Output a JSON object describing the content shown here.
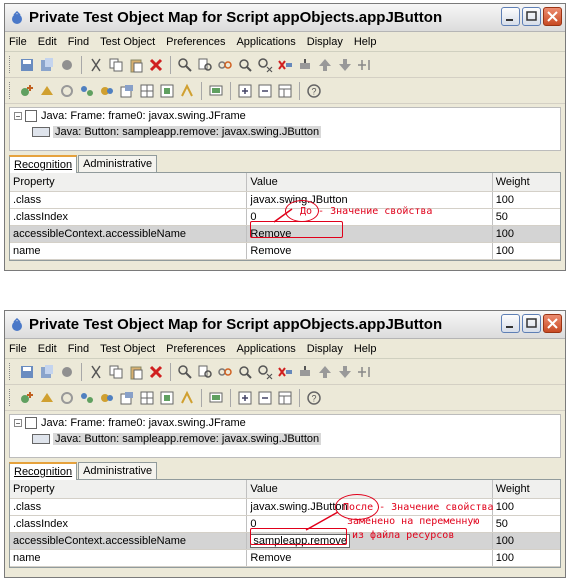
{
  "window": {
    "title": "Private Test Object Map for Script appObjects.appJButton"
  },
  "menu": [
    "File",
    "Edit",
    "Find",
    "Test Object",
    "Preferences",
    "Applications",
    "Display",
    "Help"
  ],
  "tree": {
    "frame": "Java: Frame: frame0: javax.swing.JFrame",
    "button": "Java: Button: sampleapp.remove: javax.swing.JButton"
  },
  "tabs": [
    "Recognition",
    "Administrative"
  ],
  "columns": [
    "Property",
    "Value",
    "Weight"
  ],
  "panel1": {
    "rows": [
      {
        "property": ".class",
        "value": "javax.swing.JButton",
        "weight": "100"
      },
      {
        "property": ".classIndex",
        "value": "0",
        "weight": "50"
      },
      {
        "property": "accessibleContext.accessibleName",
        "value": "Remove",
        "weight": "100"
      },
      {
        "property": "name",
        "value": "Remove",
        "weight": "100"
      }
    ],
    "annotation": "До - Значение свойства"
  },
  "panel2": {
    "rows": [
      {
        "property": ".class",
        "value": "javax.swing.JButton",
        "weight": "100"
      },
      {
        "property": ".classIndex",
        "value": "0",
        "weight": "50"
      },
      {
        "property": "accessibleContext.accessibleName",
        "value": "sampleapp.remove",
        "weight": "100"
      },
      {
        "property": "name",
        "value": "Remove",
        "weight": "100"
      }
    ],
    "annotation_line1": "После - Значение свойства",
    "annotation_line2": "заменено на переменную",
    "annotation_line3": "из файла ресурсов"
  },
  "colors": {
    "annotation": "#e0001a",
    "close_button": "#c84a24"
  }
}
